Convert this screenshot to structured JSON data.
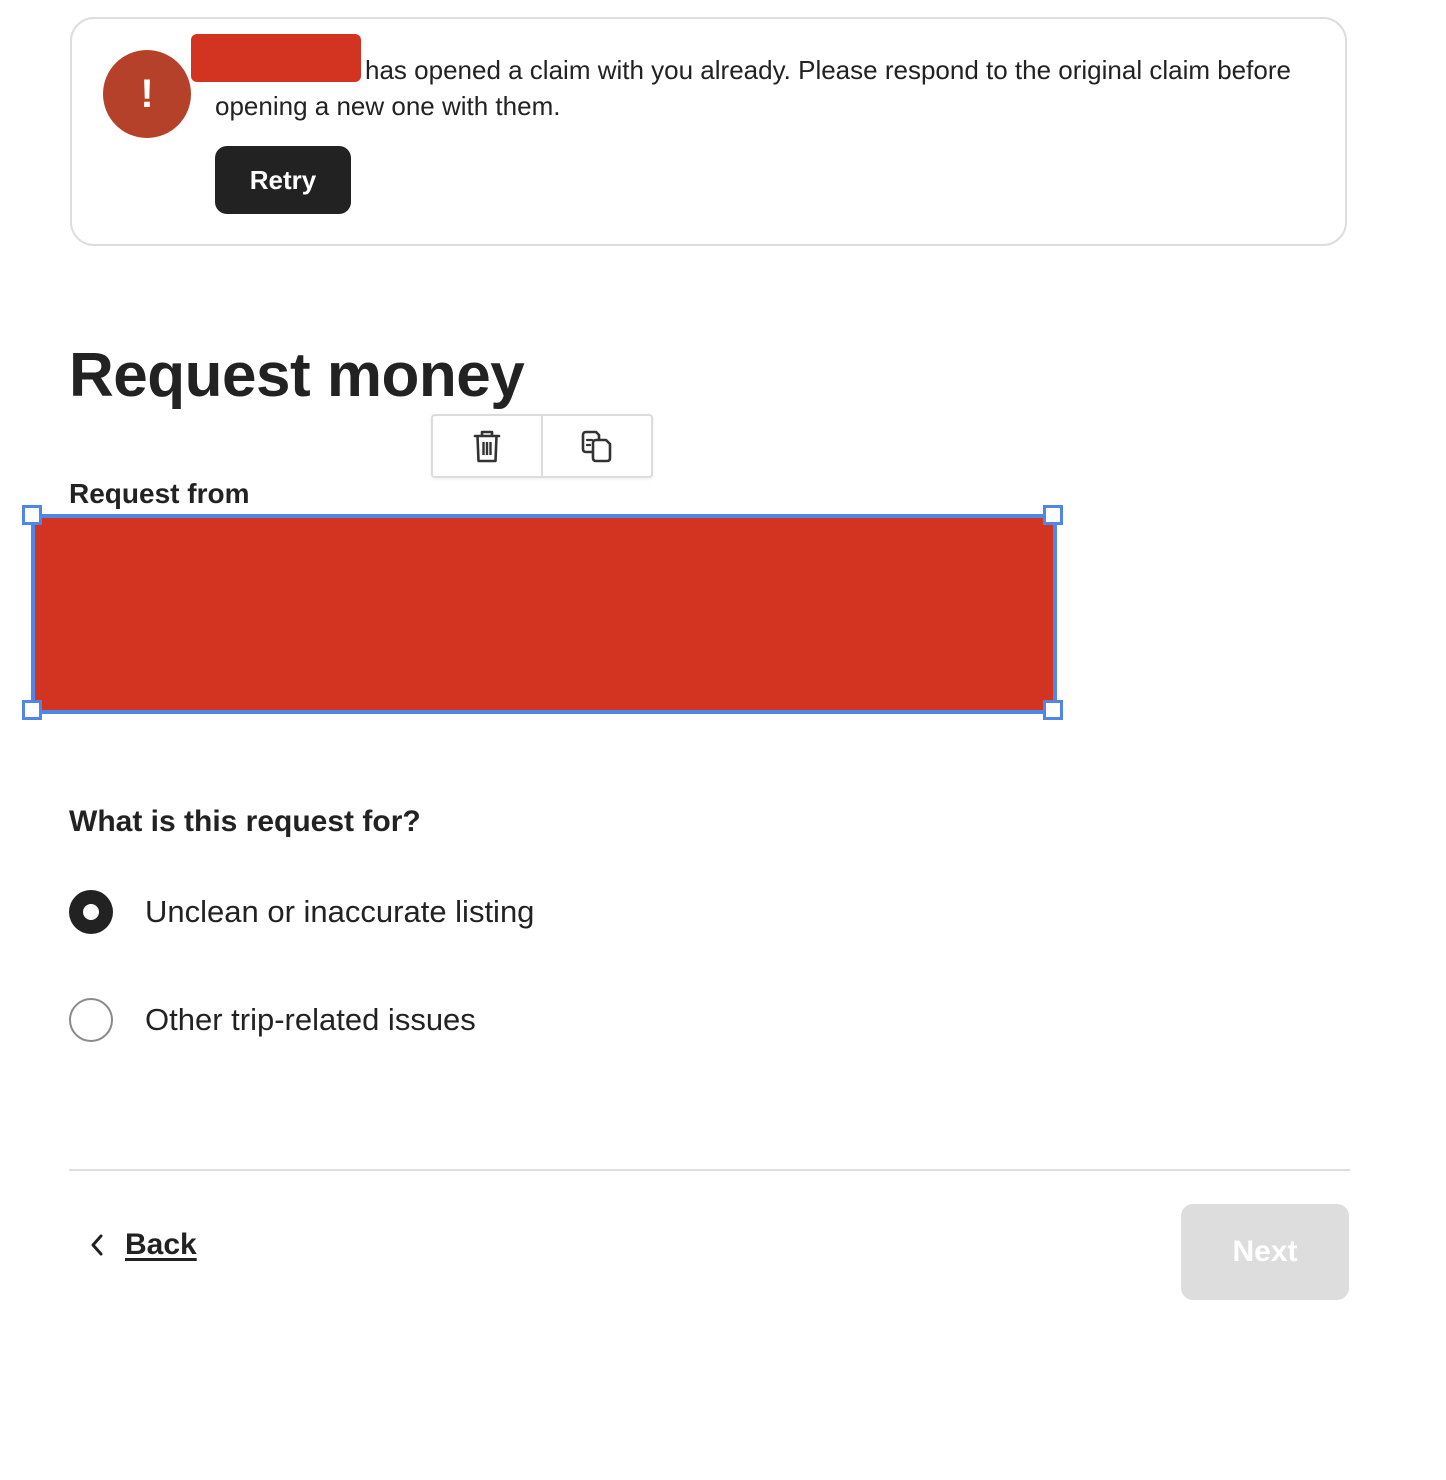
{
  "alert": {
    "icon": "exclamation-icon",
    "icon_glyph": "!",
    "icon_color": "#b6412a",
    "message": "has opened a claim with you already. Please respond to the original claim before opening a new one with them.",
    "retry_label": "Retry"
  },
  "page": {
    "title": "Request money"
  },
  "toolbar": {
    "items": [
      {
        "icon": "trash-icon"
      },
      {
        "icon": "duplicate-icon"
      }
    ]
  },
  "request_from": {
    "label": "Request from"
  },
  "question": {
    "label": "What is this request for?",
    "options": [
      {
        "label": "Unclean or inaccurate listing",
        "selected": true
      },
      {
        "label": "Other trip-related issues",
        "selected": false
      }
    ]
  },
  "footer": {
    "back_label": "Back",
    "next_label": "Next",
    "next_disabled": true
  },
  "colors": {
    "redaction": "#d33422",
    "selection": "#4f86e8",
    "dark_button": "#222222",
    "disabled_button": "#dddddd"
  }
}
